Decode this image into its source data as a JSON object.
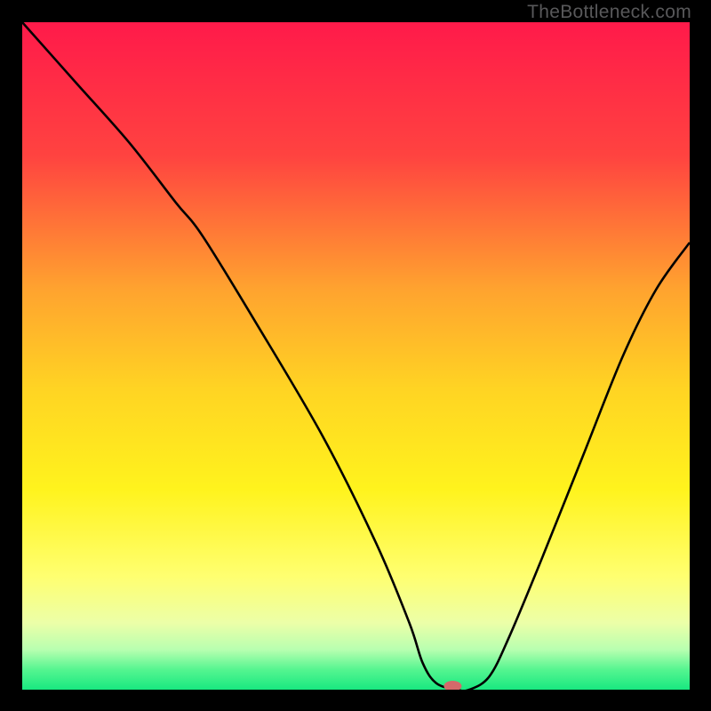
{
  "watermark": "TheBottleneck.com",
  "chart_data": {
    "type": "line",
    "title": "",
    "xlabel": "",
    "ylabel": "",
    "xlim": [
      0,
      100
    ],
    "ylim": [
      0,
      100
    ],
    "background_gradient": {
      "stops": [
        {
          "y": 0,
          "color": "#ff1a4a"
        },
        {
          "y": 20,
          "color": "#ff4340"
        },
        {
          "y": 40,
          "color": "#ffa32f"
        },
        {
          "y": 55,
          "color": "#ffd423"
        },
        {
          "y": 70,
          "color": "#fff31d"
        },
        {
          "y": 83,
          "color": "#ffff70"
        },
        {
          "y": 90,
          "color": "#ecffa8"
        },
        {
          "y": 94,
          "color": "#b8ffb0"
        },
        {
          "y": 97,
          "color": "#55f590"
        },
        {
          "y": 100,
          "color": "#18e880"
        }
      ]
    },
    "series": [
      {
        "name": "bottleneck-curve",
        "color": "#000000",
        "x": [
          0,
          8,
          16,
          23,
          27,
          35,
          45,
          53,
          58,
          60,
          62,
          65,
          67,
          70,
          73,
          78,
          84,
          90,
          95,
          100
        ],
        "y": [
          100,
          91,
          82,
          73,
          68,
          55,
          38,
          22,
          10,
          4,
          1,
          0,
          0,
          2,
          8,
          20,
          35,
          50,
          60,
          67
        ]
      }
    ],
    "marker": {
      "name": "current-point",
      "x": 64.5,
      "y": 0,
      "color": "#d46a6a",
      "rx": 10,
      "ry": 6
    }
  }
}
